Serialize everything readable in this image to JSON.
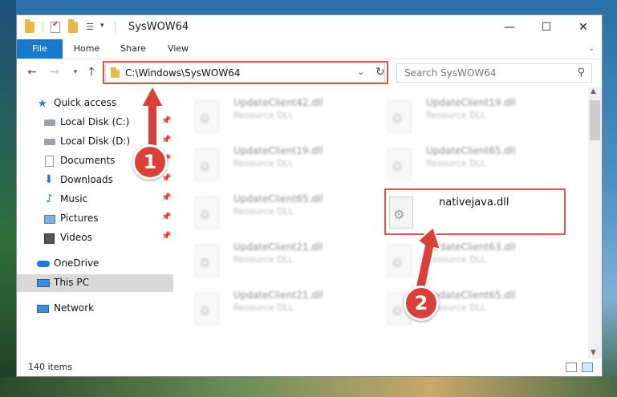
{
  "window": {
    "title": "SysWOW64",
    "controls": {
      "minimize": "—",
      "maximize": "☐",
      "close": "✕"
    }
  },
  "ribbon": {
    "tabs": [
      "File",
      "Home",
      "Share",
      "View"
    ]
  },
  "address": {
    "path": "C:\\Windows\\SysWOW64",
    "search_placeholder": "Search SysWOW64"
  },
  "sidebar": {
    "items": [
      {
        "label": "Quick access",
        "icon": "star-icon",
        "pinned": false
      },
      {
        "label": "Local Disk (C:)",
        "icon": "drive-icon",
        "pinned": true
      },
      {
        "label": "Local Disk (D:)",
        "icon": "drive-icon",
        "pinned": true
      },
      {
        "label": "Documents",
        "icon": "documents-icon",
        "pinned": true
      },
      {
        "label": "Downloads",
        "icon": "download-icon",
        "pinned": true
      },
      {
        "label": "Music",
        "icon": "music-icon",
        "pinned": true
      },
      {
        "label": "Pictures",
        "icon": "pictures-icon",
        "pinned": true
      },
      {
        "label": "Videos",
        "icon": "videos-icon",
        "pinned": true
      },
      {
        "label": "OneDrive",
        "icon": "cloud-icon",
        "pinned": false
      },
      {
        "label": "This PC",
        "icon": "computer-icon",
        "pinned": false,
        "selected": true
      },
      {
        "label": "Network",
        "icon": "network-icon",
        "pinned": false
      }
    ]
  },
  "files": [
    {
      "name": "UpdateClient42.dll",
      "type": "Resource DLL",
      "blurred": true
    },
    {
      "name": "UpdateClient19.dll",
      "type": "Resource DLL",
      "blurred": true
    },
    {
      "name": "UpdateClient19.dll",
      "type": "Resource DLL",
      "blurred": true
    },
    {
      "name": "UpdateClient65.dll",
      "type": "Resource DLL",
      "blurred": true
    },
    {
      "name": "UpdateClient65.dll",
      "type": "Resource DLL",
      "blurred": true
    },
    {
      "name": "nativejava.dll",
      "type": "",
      "blurred": false
    },
    {
      "name": "UpdateClient21.dll",
      "type": "Resource DLL",
      "blurred": true
    },
    {
      "name": "UpdateClient63.dll",
      "type": "Resource DLL",
      "blurred": true
    },
    {
      "name": "UpdateClient21.dll",
      "type": "Resource DLL",
      "blurred": true
    },
    {
      "name": "UpdateClient65.dll",
      "type": "Resource DLL",
      "blurred": true
    }
  ],
  "status": {
    "item_count": "140 items"
  },
  "annotations": {
    "step1": "1",
    "step2": "2",
    "color": "#d9403a"
  }
}
